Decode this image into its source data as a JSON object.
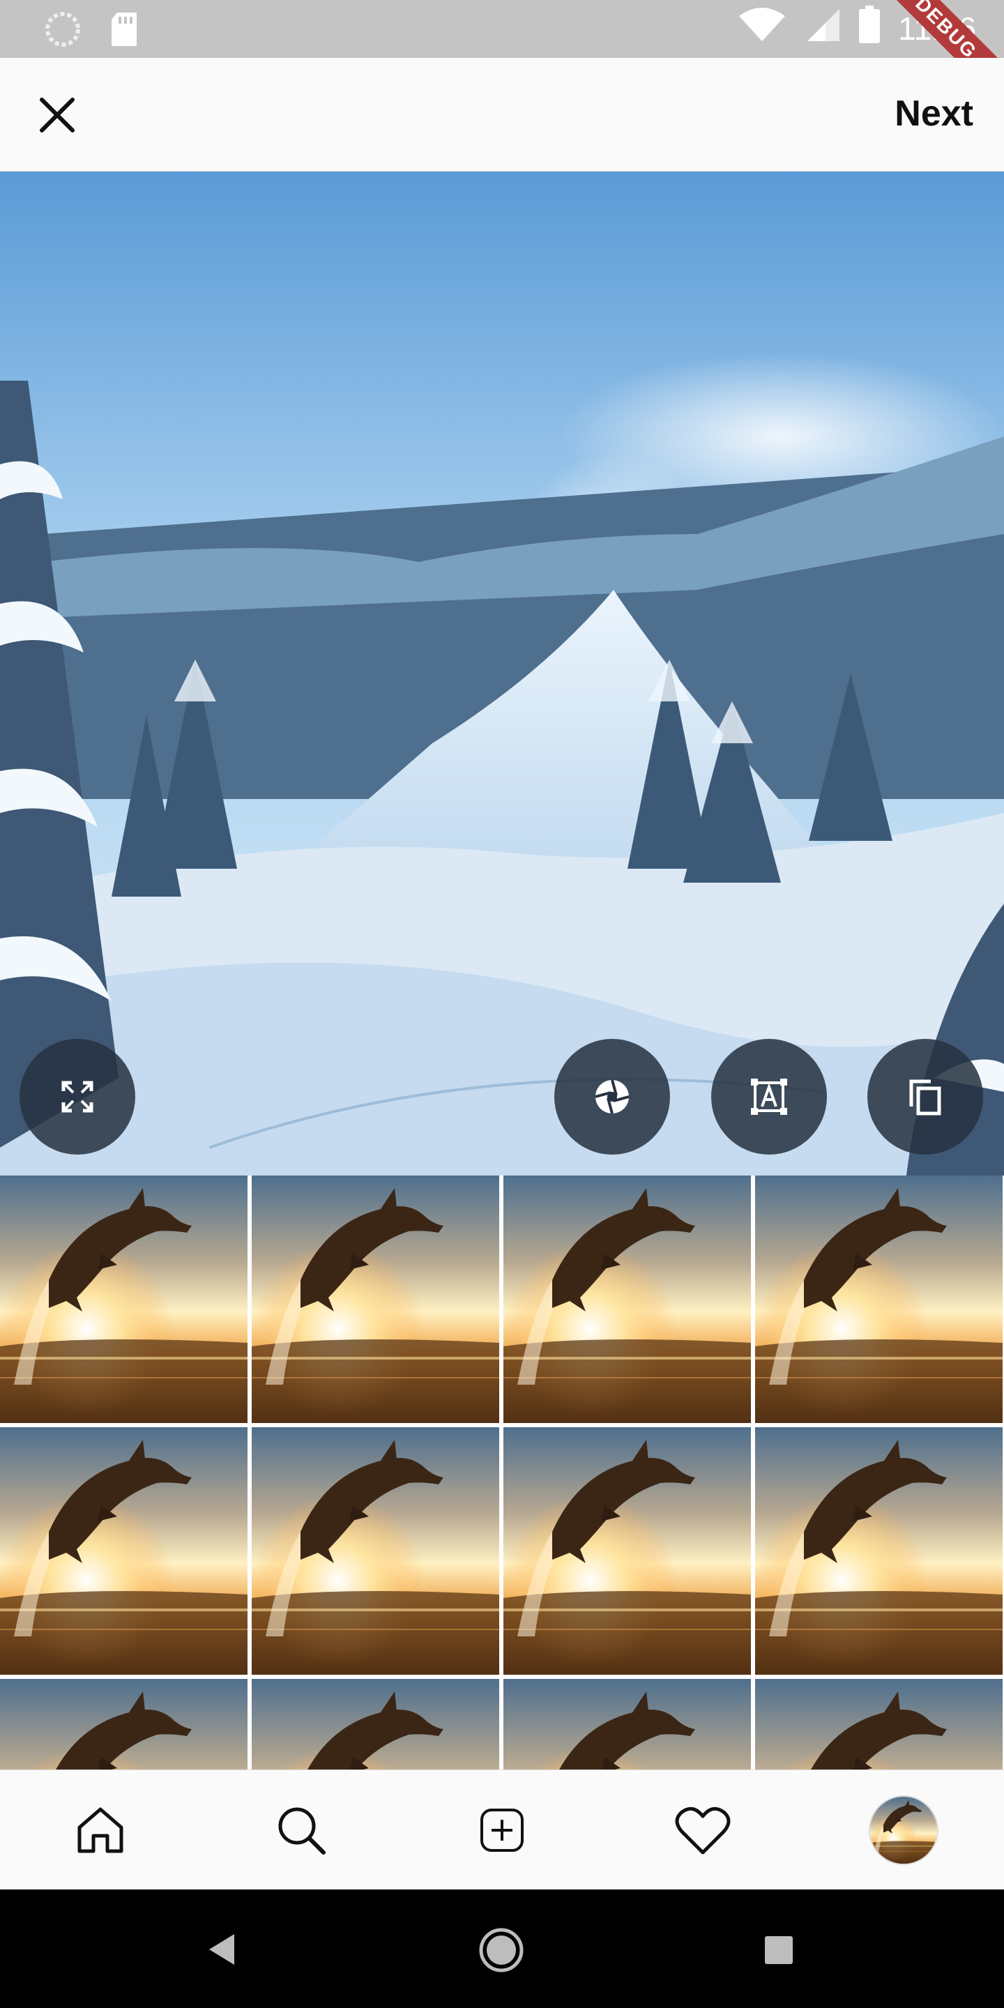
{
  "status_bar": {
    "time": "11:46",
    "debug_label": "DEBUG",
    "icons": [
      "spinner-icon",
      "sd-card-icon",
      "wifi-icon",
      "cell-signal-icon",
      "battery-icon"
    ]
  },
  "top_bar": {
    "close_icon": "close-icon",
    "next_label": "Next"
  },
  "preview": {
    "subject": "snowy-mountain-photo",
    "buttons": [
      "expand-icon",
      "aperture-icon",
      "text-box-icon",
      "copy-icon"
    ]
  },
  "gallery": {
    "thumbnail_subject": "dolphin-sunset-photo",
    "visible_count": 12
  },
  "tab_bar": {
    "items": [
      "home-icon",
      "search-icon",
      "add-post-icon",
      "heart-icon",
      "profile-avatar"
    ]
  },
  "system_nav": {
    "items": [
      "back-icon",
      "home-circle-icon",
      "recents-icon"
    ]
  },
  "colors": {
    "status_bar": "#c4c4c4",
    "top_bar": "#fafafa",
    "fab": "#263240",
    "nav_bar": "#000000",
    "debug_ribbon": "#b33a3a"
  }
}
